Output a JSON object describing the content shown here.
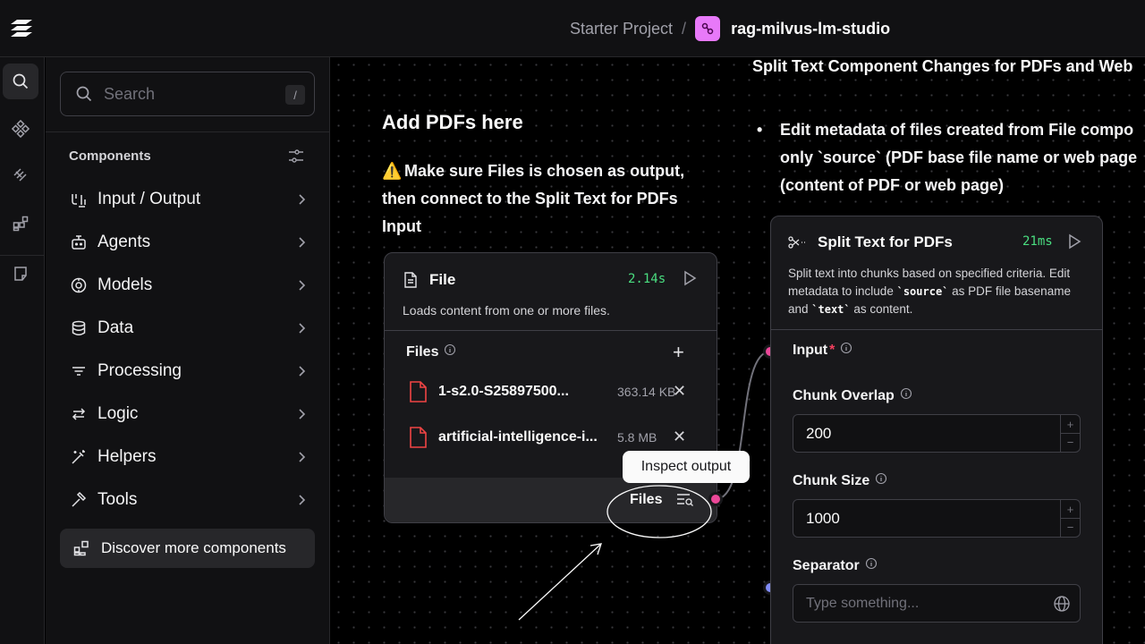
{
  "header": {
    "project": "Starter Project",
    "separator": "/",
    "flow_name": "rag-milvus-lm-studio",
    "flow_icon_color": "#e879f9"
  },
  "sidebar": {
    "search_placeholder": "Search",
    "search_shortcut": "/",
    "components_title": "Components",
    "categories": [
      {
        "label": "Input / Output",
        "icon": "input-output-icon"
      },
      {
        "label": "Agents",
        "icon": "bot-icon"
      },
      {
        "label": "Models",
        "icon": "brain-icon"
      },
      {
        "label": "Data",
        "icon": "database-icon"
      },
      {
        "label": "Processing",
        "icon": "filter-lines-icon"
      },
      {
        "label": "Logic",
        "icon": "arrows-icon"
      },
      {
        "label": "Helpers",
        "icon": "wand-icon"
      },
      {
        "label": "Tools",
        "icon": "hammer-icon"
      }
    ],
    "discover_label": "Discover more components"
  },
  "canvas": {
    "note1": {
      "title": "Add PDFs here",
      "warning_icon": "⚠️",
      "body": "Make sure Files is chosen as output, then connect to the Split Text for PDFs Input"
    },
    "note2": {
      "title": "Split Text Component Changes for PDFs and Web",
      "bullet": "•",
      "lines": [
        "Edit metadata of files created from File compo",
        "only `source` (PDF base file name or web page",
        "(content of PDF or web page)"
      ]
    },
    "file_node": {
      "title": "File",
      "time": "2.14s",
      "description": "Loads content from one or more files.",
      "files_label": "Files",
      "files": [
        {
          "name": "1-s2.0-S25897500...",
          "size": "363.14 KB"
        },
        {
          "name": "artificial-intelligence-i...",
          "size": "5.8 MB"
        }
      ],
      "output_label": "Files",
      "tooltip": "Inspect output"
    },
    "split_node": {
      "title": "Split Text for PDFs",
      "time": "21ms",
      "description_pre": "Split text into chunks based on specified criteria. Edit metadata to include ",
      "description_code1": "`source`",
      "description_mid": " as PDF file basename and ",
      "description_code2": "`text`",
      "description_post": " as content.",
      "input_label": "Input",
      "required_mark": "*",
      "chunk_overlap_label": "Chunk Overlap",
      "chunk_overlap_value": "200",
      "chunk_size_label": "Chunk Size",
      "chunk_size_value": "1000",
      "separator_label": "Separator",
      "separator_placeholder": "Type something...",
      "stepper_up": "+",
      "stepper_down": "−"
    },
    "colors": {
      "output_handle": "#ec4899",
      "input_handle": "#ec4899",
      "separator_handle": "#818cf8",
      "time_badge": "#4ade80"
    }
  }
}
